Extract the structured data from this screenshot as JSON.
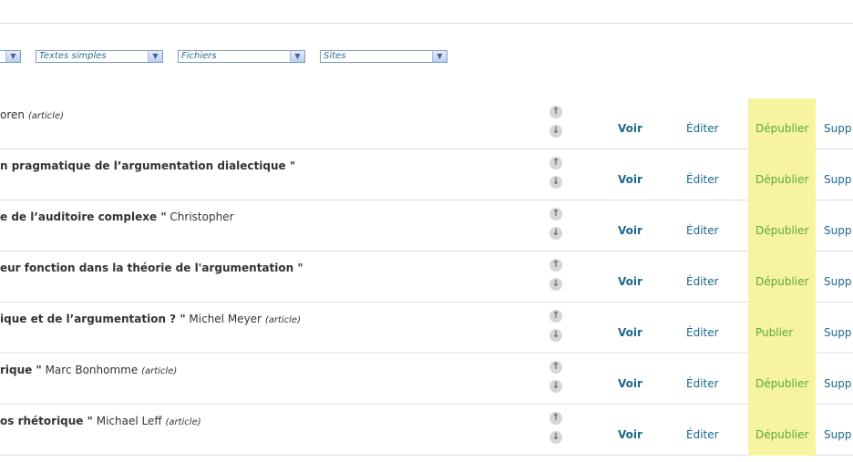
{
  "filters": [
    {
      "value": ""
    },
    {
      "value": "Textes simples"
    },
    {
      "value": "Fichiers"
    },
    {
      "value": "Sites"
    }
  ],
  "actions": {
    "view": "Voir",
    "edit": "Éditer",
    "delete": "Supp"
  },
  "rows": [
    {
      "title": "",
      "author": "oren",
      "kind": "(article)",
      "status_action": "Dépublier"
    },
    {
      "title": "n pragmatique de l’argumentation dialectique \"",
      "author": "",
      "kind": "",
      "status_action": "Dépublier"
    },
    {
      "title": "e de l’auditoire complexe \"",
      "author": "Christopher",
      "kind": "",
      "status_action": "Dépublier"
    },
    {
      "title": "eur fonction dans la théorie de l'argumentation \"",
      "author": "",
      "kind": "",
      "status_action": "Dépublier"
    },
    {
      "title": "ique et de l’argumentation ? \"",
      "author": "Michel Meyer",
      "kind": "(article)",
      "status_action": "Publier"
    },
    {
      "title": "rique \"",
      "author": "Marc Bonhomme",
      "kind": "(article)",
      "status_action": "Dépublier"
    },
    {
      "title": "os rhétorique \"",
      "author": "Michael Leff",
      "kind": "(article)",
      "status_action": "Dépublier"
    }
  ]
}
